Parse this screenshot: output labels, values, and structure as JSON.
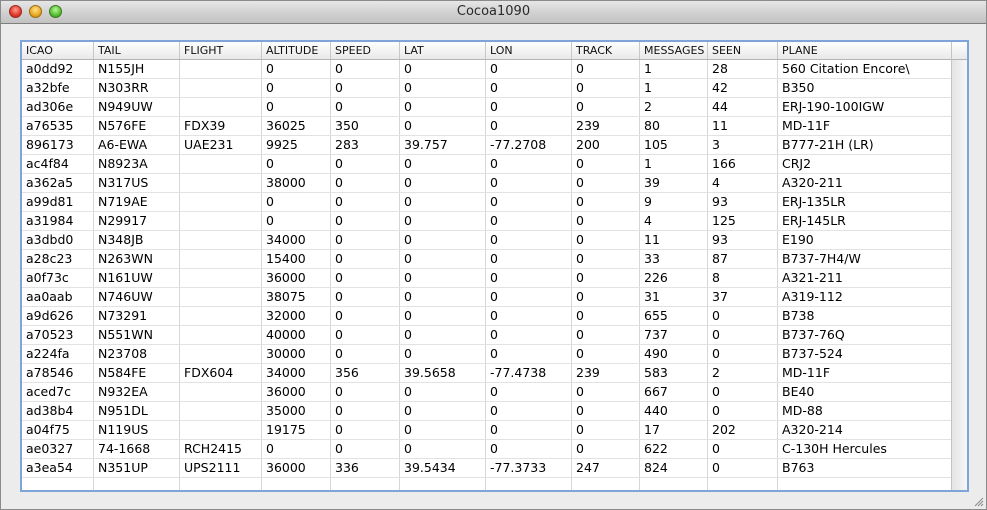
{
  "window": {
    "title": "Cocoa1090"
  },
  "table": {
    "columns": [
      "ICAO",
      "TAIL",
      "FLIGHT",
      "ALTITUDE",
      "SPEED",
      "LAT",
      "LON",
      "TRACK",
      "MESSAGES",
      "SEEN",
      "PLANE"
    ],
    "rows": [
      [
        "a0dd92",
        "N155JH",
        "",
        "0",
        "0",
        "0",
        "0",
        "0",
        "1",
        "28",
        "560 Citation Encore\\"
      ],
      [
        "a32bfe",
        "N303RR",
        "",
        "0",
        "0",
        "0",
        "0",
        "0",
        "1",
        "42",
        "B350"
      ],
      [
        "ad306e",
        "N949UW",
        "",
        "0",
        "0",
        "0",
        "0",
        "0",
        "2",
        "44",
        "ERJ-190-100IGW"
      ],
      [
        "a76535",
        "N576FE",
        "FDX39",
        "36025",
        "350",
        "0",
        "0",
        "239",
        "80",
        "11",
        "MD-11F"
      ],
      [
        "896173",
        "A6-EWA",
        "UAE231",
        "9925",
        "283",
        "39.757",
        "-77.2708",
        "200",
        "105",
        "3",
        "B777-21H (LR)"
      ],
      [
        "ac4f84",
        "N8923A",
        "",
        "0",
        "0",
        "0",
        "0",
        "0",
        "1",
        "166",
        "CRJ2"
      ],
      [
        "a362a5",
        "N317US",
        "",
        "38000",
        "0",
        "0",
        "0",
        "0",
        "39",
        "4",
        "A320-211"
      ],
      [
        "a99d81",
        "N719AE",
        "",
        "0",
        "0",
        "0",
        "0",
        "0",
        "9",
        "93",
        "ERJ-135LR"
      ],
      [
        "a31984",
        "N29917",
        "",
        "0",
        "0",
        "0",
        "0",
        "0",
        "4",
        "125",
        "ERJ-145LR"
      ],
      [
        "a3dbd0",
        "N348JB",
        "",
        "34000",
        "0",
        "0",
        "0",
        "0",
        "11",
        "93",
        "E190"
      ],
      [
        "a28c23",
        "N263WN",
        "",
        "15400",
        "0",
        "0",
        "0",
        "0",
        "33",
        "87",
        "B737-7H4/W"
      ],
      [
        "a0f73c",
        "N161UW",
        "",
        "36000",
        "0",
        "0",
        "0",
        "0",
        "226",
        "8",
        "A321-211"
      ],
      [
        "aa0aab",
        "N746UW",
        "",
        "38075",
        "0",
        "0",
        "0",
        "0",
        "31",
        "37",
        "A319-112"
      ],
      [
        "a9d626",
        "N73291",
        "",
        "32000",
        "0",
        "0",
        "0",
        "0",
        "655",
        "0",
        "B738"
      ],
      [
        "a70523",
        "N551WN",
        "",
        "40000",
        "0",
        "0",
        "0",
        "0",
        "737",
        "0",
        "B737-76Q"
      ],
      [
        "a224fa",
        "N23708",
        "",
        "30000",
        "0",
        "0",
        "0",
        "0",
        "490",
        "0",
        "B737-524"
      ],
      [
        "a78546",
        "N584FE",
        "FDX604",
        "34000",
        "356",
        "39.5658",
        "-77.4738",
        "239",
        "583",
        "2",
        "MD-11F"
      ],
      [
        "aced7c",
        "N932EA",
        "",
        "36000",
        "0",
        "0",
        "0",
        "0",
        "667",
        "0",
        "BE40"
      ],
      [
        "ad38b4",
        "N951DL",
        "",
        "35000",
        "0",
        "0",
        "0",
        "0",
        "440",
        "0",
        "MD-88"
      ],
      [
        "a04f75",
        "N119US",
        "",
        "19175",
        "0",
        "0",
        "0",
        "0",
        "17",
        "202",
        "A320-214"
      ],
      [
        "ae0327",
        "74-1668",
        "RCH2415",
        "0",
        "0",
        "0",
        "0",
        "0",
        "622",
        "0",
        "C-130H Hercules"
      ],
      [
        "a3ea54",
        "N351UP",
        "UPS2111",
        "36000",
        "336",
        "39.5434",
        "-77.3733",
        "247",
        "824",
        "0",
        "B763"
      ],
      [
        "",
        "",
        "",
        "",
        "",
        "",
        "",
        "",
        "",
        "",
        ""
      ]
    ]
  },
  "colors": {
    "focus_ring": "#7ea4d9",
    "close": "#e2372b",
    "minimize": "#e9a91f",
    "zoom": "#55bf2f"
  }
}
